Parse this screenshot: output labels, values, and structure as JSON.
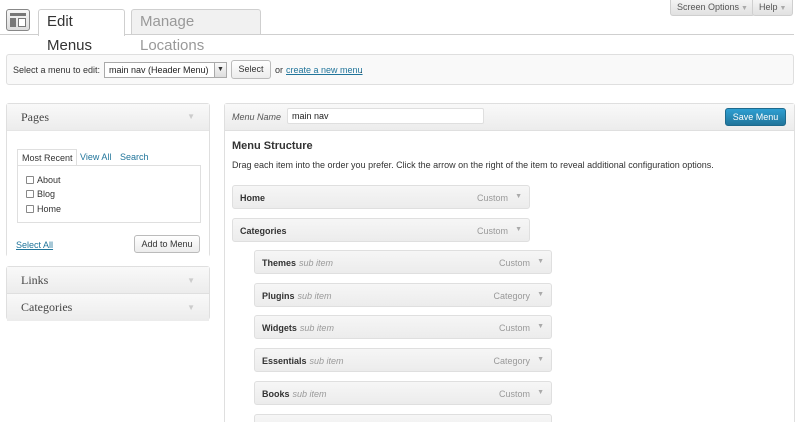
{
  "tabs": {
    "edit_menus": "Edit Menus",
    "manage_locations": "Manage Locations"
  },
  "top_buttons": {
    "screen_options": "Screen Options",
    "help": "Help"
  },
  "menu_select": {
    "label": "Select a menu to edit:",
    "selected": "main nav (Header Menu)",
    "select_button": "Select",
    "or_text": "or",
    "create_link": "create a new menu",
    "period": "."
  },
  "sidebar": {
    "pages": {
      "title": "Pages",
      "tabs": [
        "Most Recent",
        "View All",
        "Search"
      ],
      "items": [
        "About",
        "Blog",
        "Home"
      ],
      "select_all": "Select All",
      "add_button": "Add to Menu"
    },
    "links": {
      "title": "Links"
    },
    "categories": {
      "title": "Categories"
    }
  },
  "main": {
    "menu_name_label": "Menu Name",
    "menu_name_value": "main nav",
    "save_button": "Save Menu",
    "structure_title": "Menu Structure",
    "structure_desc": "Drag each item into the order you prefer. Click the arrow on the right of the item to reveal additional configuration options.",
    "items": [
      {
        "title": "Home",
        "sub": "",
        "type": "Custom"
      },
      {
        "title": "Categories",
        "sub": "",
        "type": "Custom"
      },
      {
        "title": "Themes",
        "sub": "sub item",
        "type": "Custom"
      },
      {
        "title": "Plugins",
        "sub": "sub item",
        "type": "Category"
      },
      {
        "title": "Widgets",
        "sub": "sub item",
        "type": "Custom"
      },
      {
        "title": "Essentials",
        "sub": "sub item",
        "type": "Category"
      },
      {
        "title": "Books",
        "sub": "sub item",
        "type": "Custom"
      }
    ]
  },
  "icons": {
    "page_icon": "menus-page-icon",
    "dropdown": "chevron-down-icon"
  }
}
